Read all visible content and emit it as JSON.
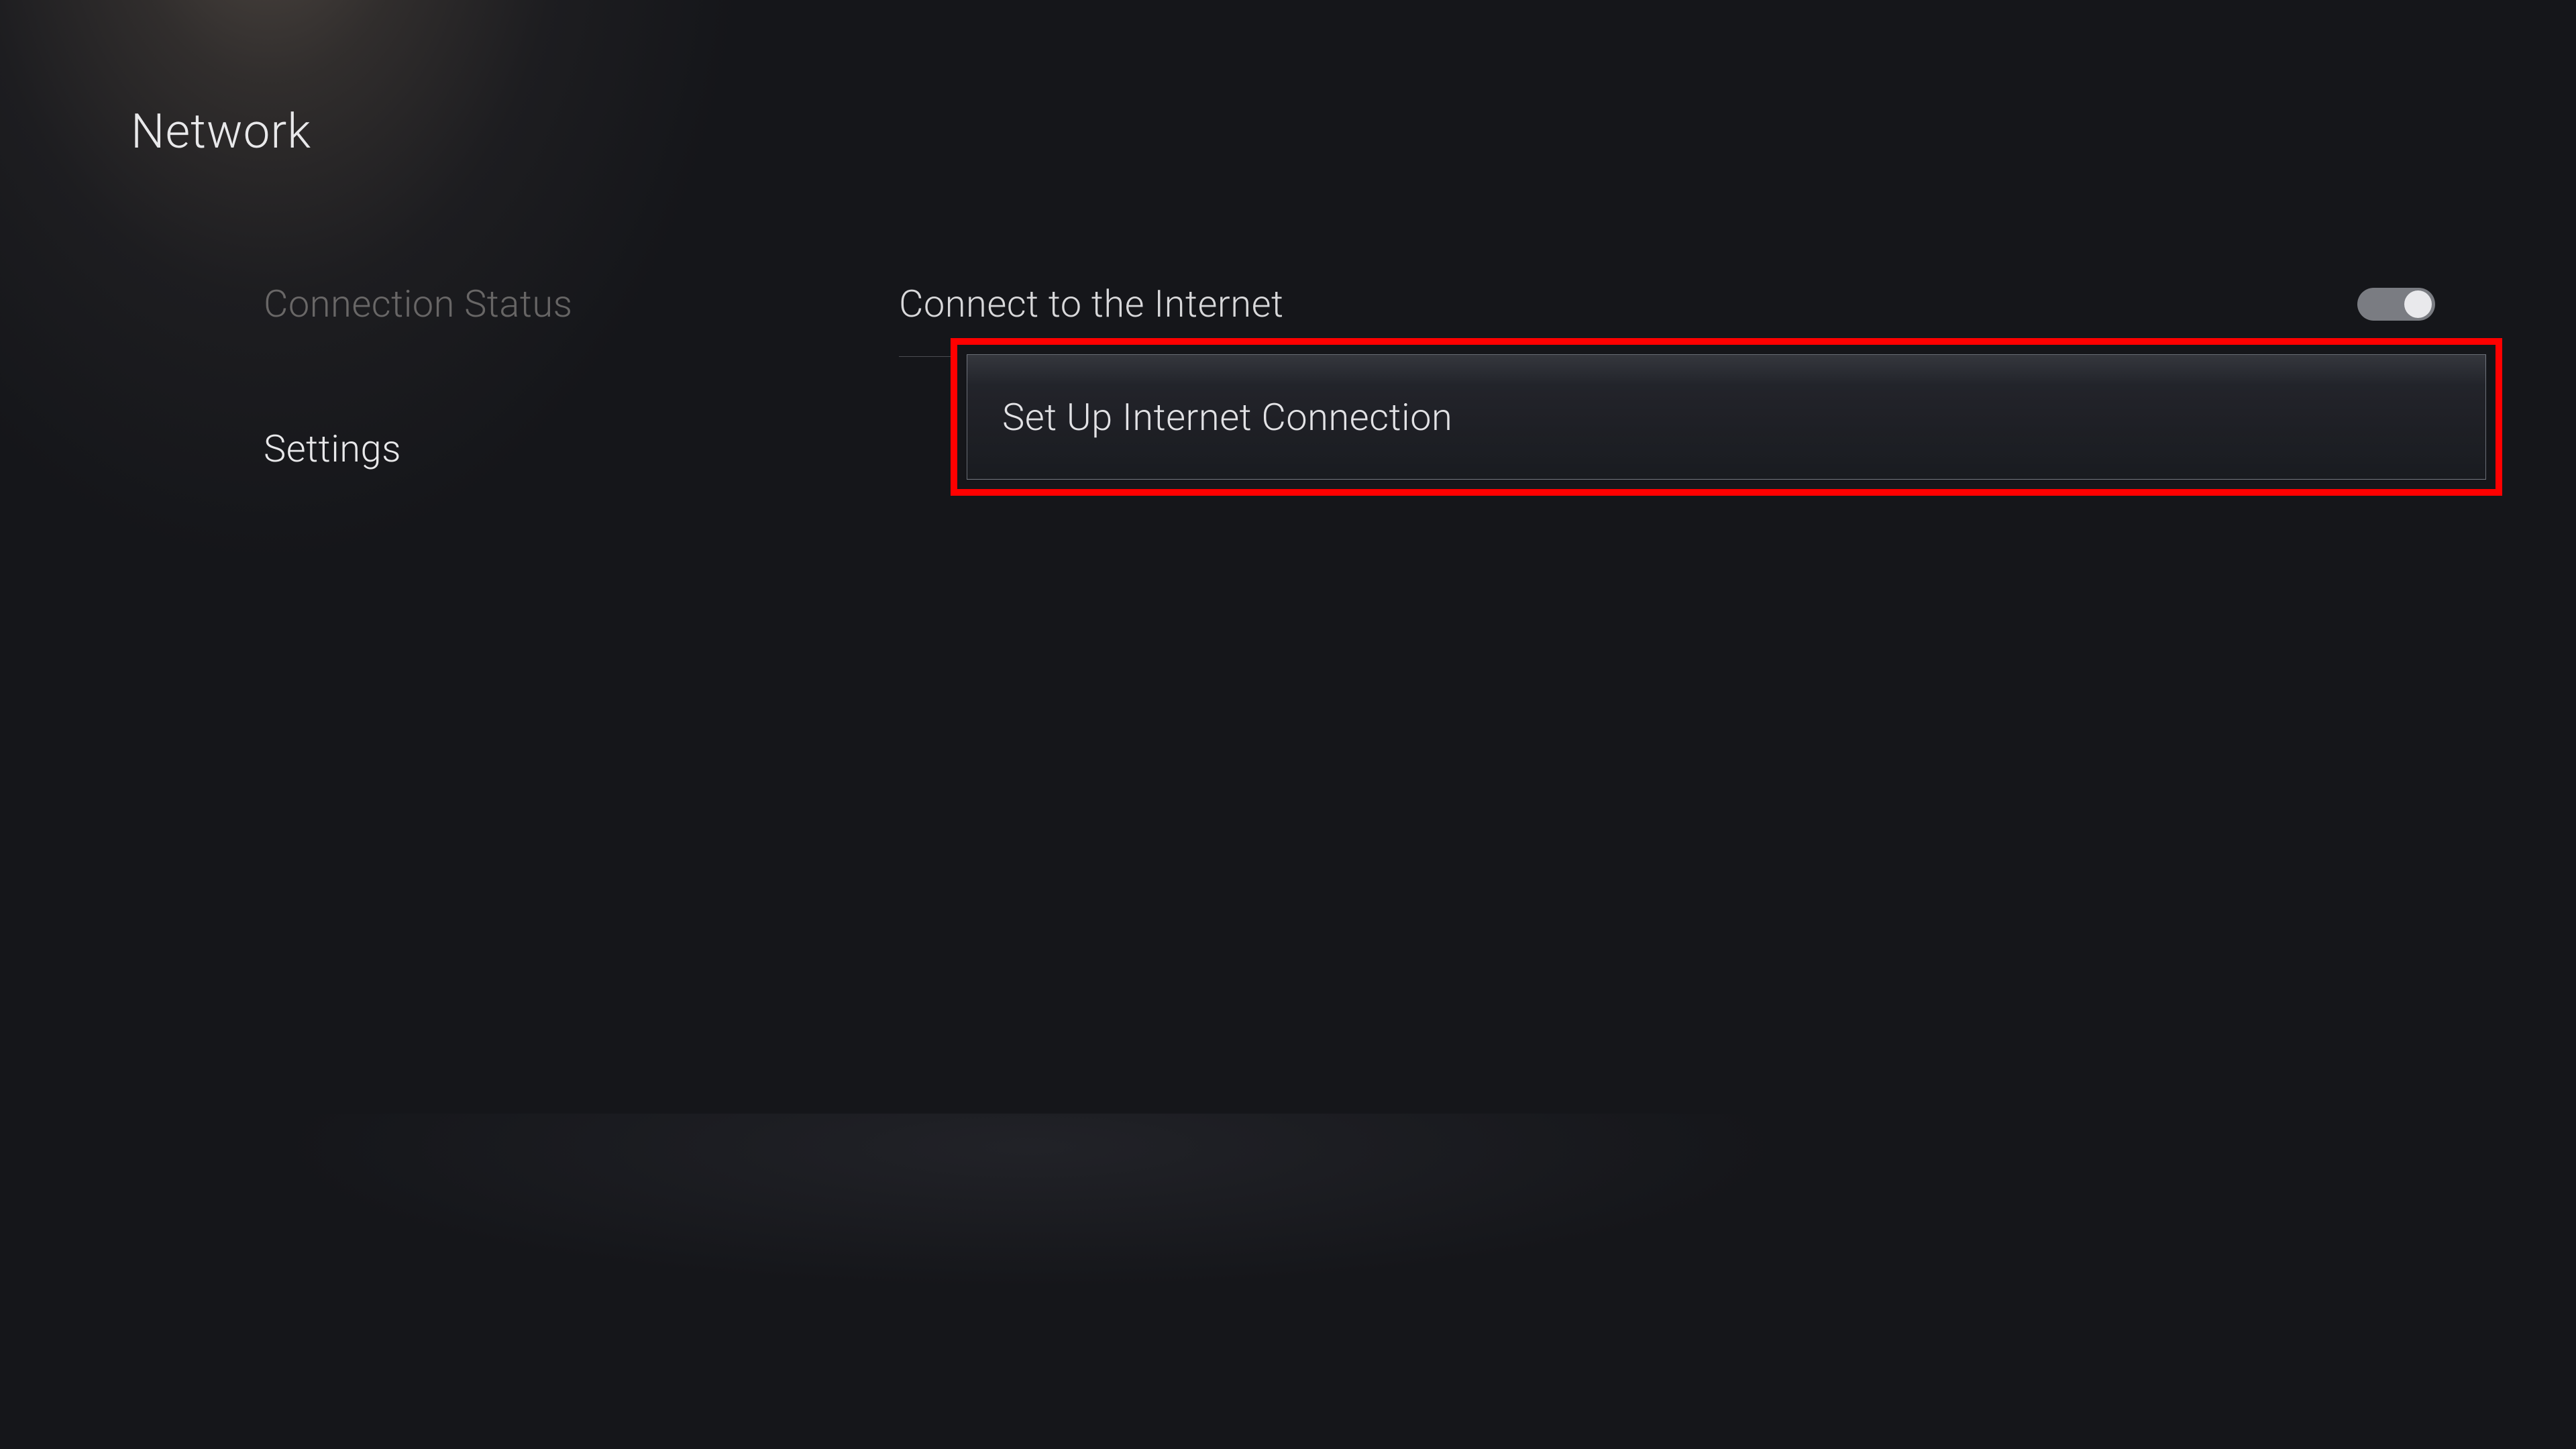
{
  "header": {
    "title": "Network"
  },
  "sidebar": {
    "items": [
      {
        "label": "Connection Status",
        "active": false
      },
      {
        "label": "Settings",
        "active": true
      }
    ]
  },
  "main": {
    "connect_row": {
      "label": "Connect to the Internet",
      "toggle_on": true
    },
    "items": [
      {
        "label": "Set Up Internet Connection",
        "highlighted": true
      }
    ]
  },
  "annotation": {
    "highlight_color": "#ff0000"
  }
}
